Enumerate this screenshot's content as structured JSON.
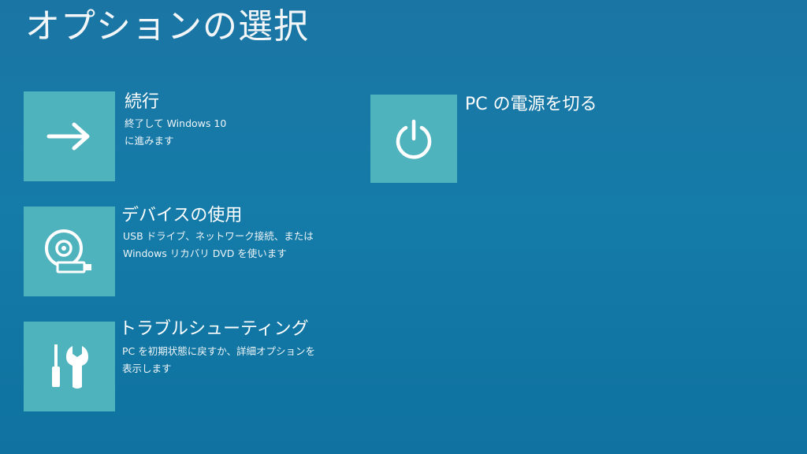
{
  "page": {
    "title": "オプションの選択"
  },
  "options": [
    {
      "id": "continue",
      "title": "続行",
      "desc_line1": "終了して Windows 10",
      "desc_line2": "に進みます",
      "icon": "arrow-right-icon"
    },
    {
      "id": "use-device",
      "title": "デバイスの使用",
      "desc_line1": "USB ドライブ、ネットワーク接続、または",
      "desc_line2": "Windows リカバリ DVD を使います",
      "icon": "disc-usb-icon"
    },
    {
      "id": "troubleshoot",
      "title": "トラブルシューティング",
      "desc_line1": "PC を初期状態に戻すか、詳細オプションを",
      "desc_line2": "表示します",
      "icon": "screwdriver-wrench-icon"
    },
    {
      "id": "turn-off",
      "title": "PC の電源を切る",
      "icon": "power-icon"
    }
  ],
  "colors": {
    "background": "#157ba8",
    "tile": "#4fb3be",
    "text": "#ffffff"
  }
}
